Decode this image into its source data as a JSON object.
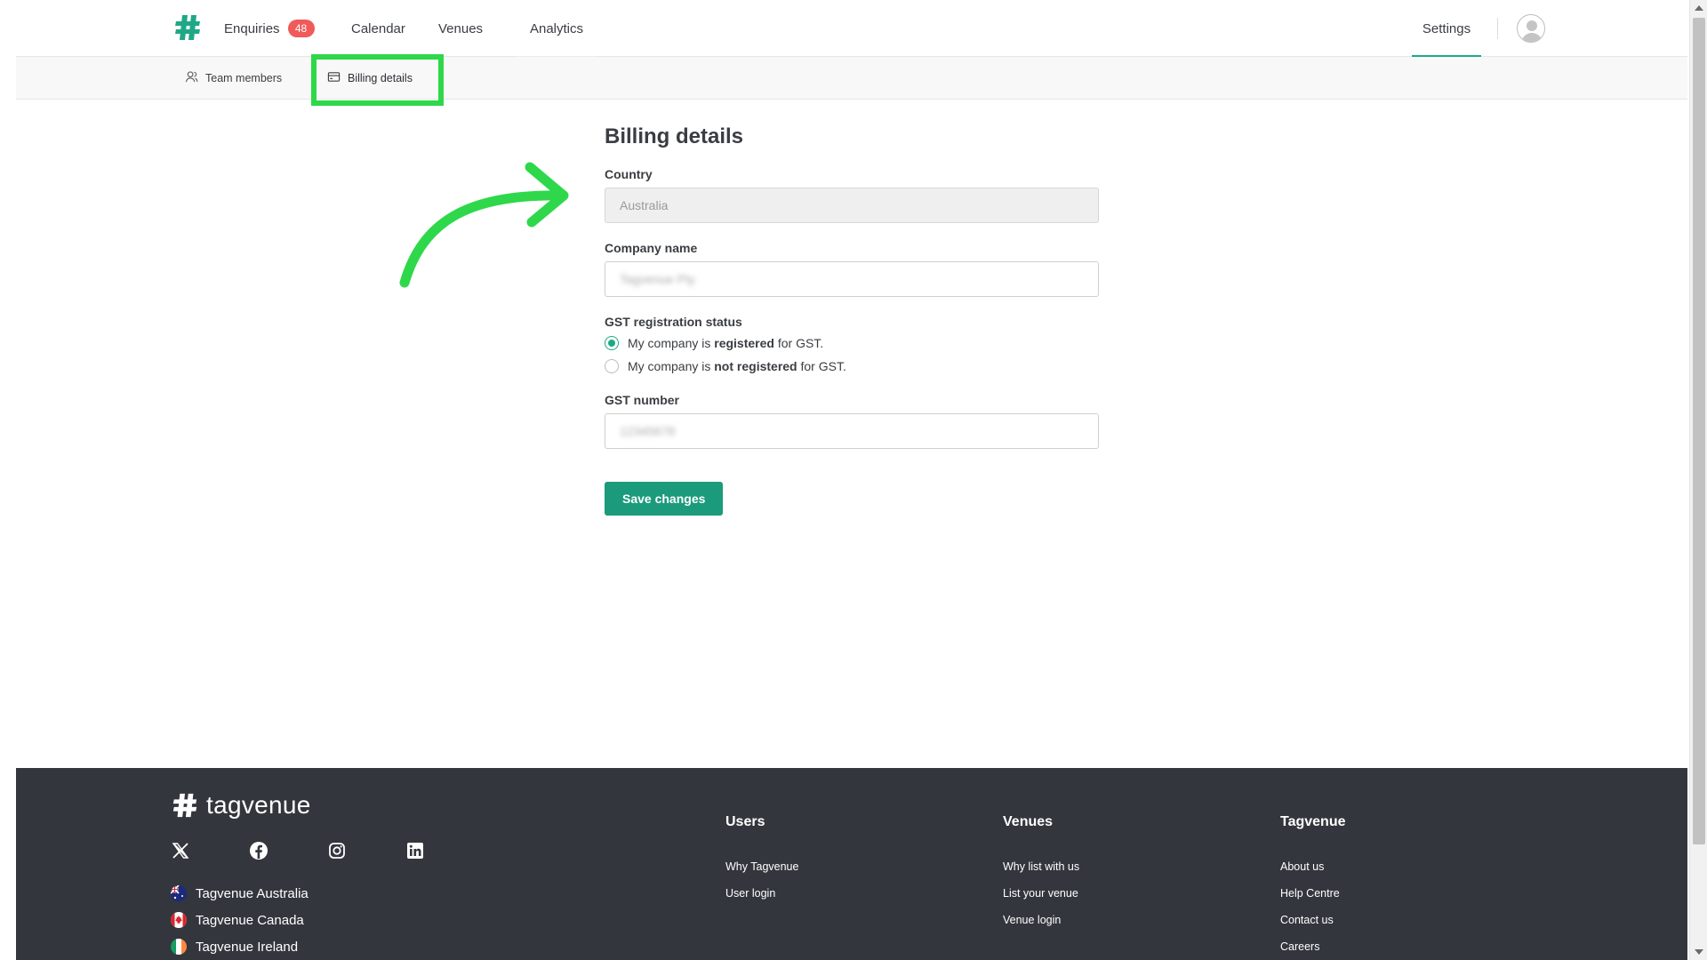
{
  "nav": {
    "enquiries_label": "Enquiries",
    "enquiries_count": "48",
    "calendar_label": "Calendar",
    "venues_label": "Venues",
    "analytics_label": "Analytics",
    "settings_label": "Settings"
  },
  "subnav": {
    "team_members_label": "Team members",
    "billing_details_label": "Billing details"
  },
  "form": {
    "title": "Billing details",
    "country_label": "Country",
    "country_value": "Australia",
    "company_name_label": "Company name",
    "company_name_value": "Tagvenue Pty",
    "gst_status_label": "GST registration status",
    "gst_registered": {
      "prefix": "My company is",
      "bold": "registered",
      "suffix": "for GST."
    },
    "gst_not_registered": {
      "prefix": "My company is",
      "bold": "not registered",
      "suffix": "for GST."
    },
    "gst_number_label": "GST number",
    "gst_number_value": "12345678",
    "save_label": "Save changes"
  },
  "footer": {
    "brand": "tagvenue",
    "countries": [
      "Tagvenue Australia",
      "Tagvenue Canada",
      "Tagvenue Ireland"
    ],
    "columns": [
      {
        "title": "Users",
        "links": [
          "Why Tagvenue",
          "User login"
        ]
      },
      {
        "title": "Venues",
        "links": [
          "Why list with us",
          "List your venue",
          "Venue login"
        ]
      },
      {
        "title": "Tagvenue",
        "links": [
          "About us",
          "Help Centre",
          "Contact us",
          "Careers"
        ]
      }
    ]
  },
  "colors": {
    "accent": "#1fa887",
    "button": "#1b9a7c",
    "badge": "#f05a5a",
    "annotation": "#2ed84a",
    "footer_bg": "#33363d"
  }
}
